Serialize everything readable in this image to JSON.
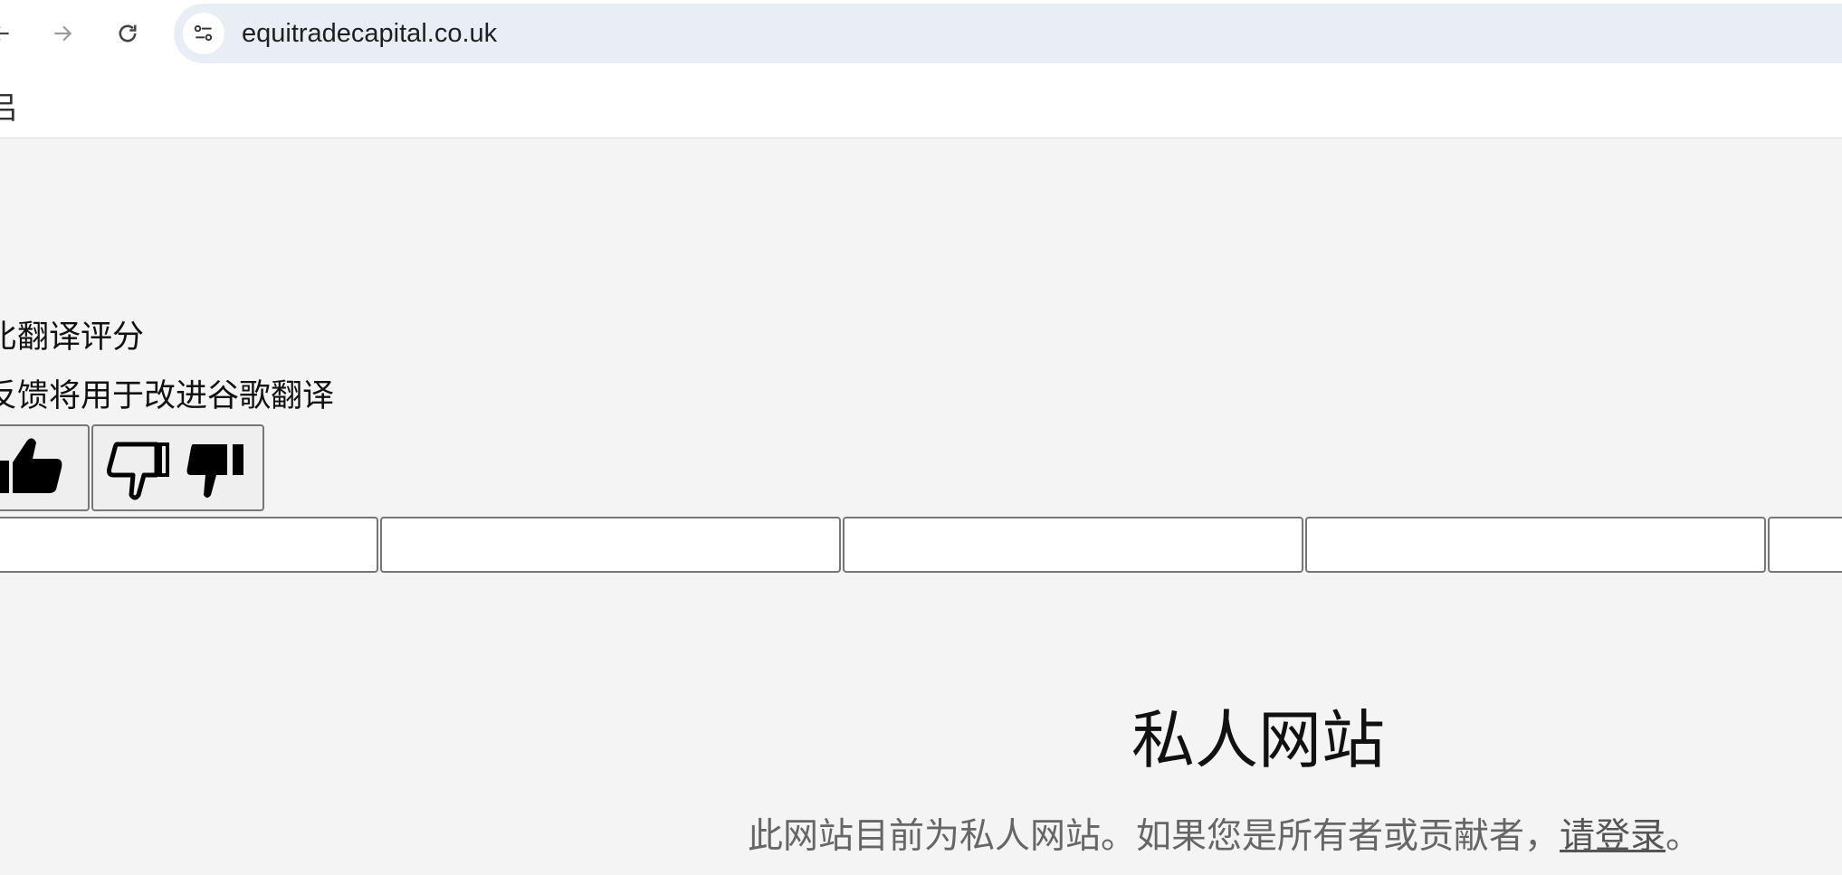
{
  "browser": {
    "url": "equitradecapital.co.uk",
    "bookmarks_partial_glyph": "吕"
  },
  "translate_feedback": {
    "title": "比翻译评分",
    "subtitle": "反馈将用于改进谷歌翻译",
    "thumbs_up_icon": "thumbs-up-icon",
    "thumbs_down_icon": "thumbs-down-icon"
  },
  "page": {
    "title": "私人网站",
    "message_prefix": "此网站目前为私人网站。如果您是所有者或贡献者，",
    "login_link": "请登录",
    "message_suffix": "。"
  }
}
